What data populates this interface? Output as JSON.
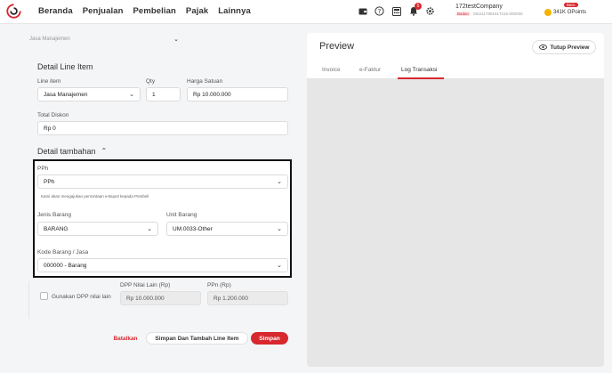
{
  "nav": {
    "items": [
      "Beranda",
      "Penjualan",
      "Pembelian",
      "Pajak",
      "Lainnya"
    ]
  },
  "header": {
    "notification_count": "5",
    "company_name": "172testCompany",
    "company_type": "Badan",
    "company_npwp": "0911117991517215-000000",
    "points_badge": "Baru",
    "points": "341K OPoints"
  },
  "form": {
    "faded_select": "Jasa Manajemen",
    "detail_title": "Detail Line Item",
    "line_item_label": "Line item",
    "line_item_value": "Jasa Manajemen",
    "qty_label": "Qty",
    "qty_value": "1",
    "harga_label": "Harga Satuan",
    "harga_value": "Rp 10.000.000",
    "diskon_label": "Total Diskon",
    "diskon_value": "Rp 0",
    "tambahan_title": "Detail tambahan",
    "pph_label": "PPh",
    "pph_value": "PPh",
    "pph_note": "Kami akan mengajukan permintaan e-Bupot kepada Pembeli",
    "jenis_label": "Jenis Barang",
    "jenis_value": "BARANG",
    "unit_label": "Unit Barang",
    "unit_value": "UM.0033-Other",
    "kode_label": "Kode Barang / Jasa",
    "kode_value": "000000 - Barang",
    "dpp_checkbox_label": "Gunakan DPP nilai lain",
    "dpp_label": "DPP Nilai Lain (Rp)",
    "dpp_value": "Rp 10.000.000",
    "ppn_label": "PPn (Rp)",
    "ppn_value": "Rp 1.200.000",
    "batalkan": "Batalkan",
    "simpan_tambah": "Simpan Dan Tambah Line Item",
    "simpan": "Simpan"
  },
  "preview": {
    "title": "Preview",
    "close_label": "Tutup Preview",
    "tabs": [
      "Invoice",
      "e-Faktur",
      "Log Transaksi"
    ],
    "active_tab": "Log Transaksi"
  },
  "colors": {
    "accent": "#d7282f"
  }
}
